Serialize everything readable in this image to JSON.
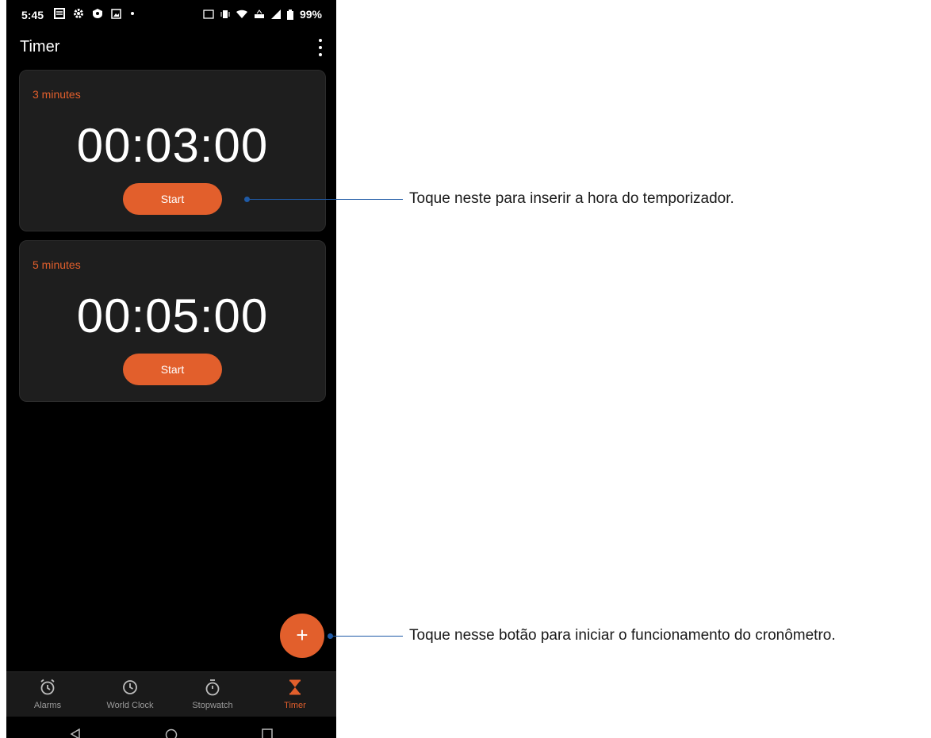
{
  "status_bar": {
    "time": "5:45",
    "battery": "99%"
  },
  "app": {
    "title": "Timer"
  },
  "timers": [
    {
      "label": "3 minutes",
      "time": "00:03:00",
      "button": "Start"
    },
    {
      "label": "5 minutes",
      "time": "00:05:00",
      "button": "Start"
    }
  ],
  "fab": {
    "label": "+"
  },
  "bottom_nav": {
    "items": [
      {
        "label": "Alarms",
        "icon": "alarm-icon"
      },
      {
        "label": "World Clock",
        "icon": "clock-icon"
      },
      {
        "label": "Stopwatch",
        "icon": "stopwatch-icon"
      },
      {
        "label": "Timer",
        "icon": "hourglass-icon",
        "active": true
      }
    ]
  },
  "callouts": [
    {
      "text": "Toque neste para inserir a hora do temporizador."
    },
    {
      "text": "Toque nesse botão para iniciar o funcionamento do cronômetro."
    }
  ],
  "colors": {
    "accent": "#e25f2c",
    "callout": "#1f5aa6",
    "card": "#1e1e1e"
  }
}
